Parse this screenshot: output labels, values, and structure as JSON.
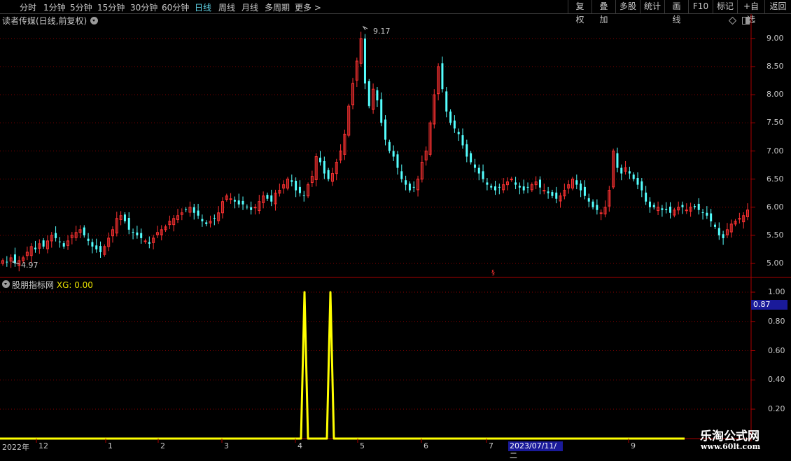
{
  "toolbar": {
    "timeframes": [
      "分时",
      "1分钟",
      "5分钟",
      "15分钟",
      "30分钟",
      "60分钟",
      "日线",
      "周线",
      "月线",
      "多周期",
      "更多 >"
    ],
    "active_timeframe": "日线",
    "right_buttons": [
      "复权",
      "叠加",
      "多股",
      "统计",
      "画线",
      "F10",
      "标记",
      "+自选",
      "返回"
    ]
  },
  "chart_title": "读者传媒(日线,前复权)",
  "price_axis": [
    "9.00",
    "8.50",
    "8.00",
    "7.50",
    "7.00",
    "6.50",
    "6.00",
    "5.50",
    "5.00"
  ],
  "max_label": "9.17",
  "min_label": "4.97",
  "indicator": {
    "name": "股朋指标网",
    "xg_label": "XG: 0.00",
    "axis": [
      "1.00",
      "0.80",
      "0.60",
      "0.40",
      "0.20"
    ],
    "current_value": "0.87"
  },
  "date_axis": {
    "labels": [
      "2022年",
      "12",
      "1",
      "2",
      "3",
      "4",
      "5",
      "6",
      "7",
      "9"
    ],
    "highlight": "2023/07/11/二"
  },
  "watermark": {
    "title": "乐淘公式网",
    "url": "www.60lt.com"
  },
  "colors": {
    "up": "#ff3232",
    "down": "#54ffff",
    "signal": "#ffff00",
    "grid": "#8b0000"
  },
  "chart_data": {
    "type": "candlestick",
    "series": [
      {
        "name": "price",
        "values": [
          5.05,
          5.02,
          5.1,
          5.0,
          5.05,
          5.1,
          5.2,
          5.3,
          5.25,
          5.35,
          5.3,
          5.4,
          5.5,
          5.45,
          5.38,
          5.3,
          5.4,
          5.5,
          5.55,
          5.6,
          5.5,
          5.4,
          5.3,
          5.25,
          5.2,
          5.3,
          5.45,
          5.6,
          5.8,
          5.85,
          5.75,
          5.6,
          5.55,
          5.5,
          5.45,
          5.4,
          5.35,
          5.45,
          5.55,
          5.6,
          5.65,
          5.75,
          5.8,
          5.85,
          5.9,
          5.95,
          6.0,
          5.9,
          5.85,
          5.75,
          5.7,
          5.75,
          5.8,
          5.9,
          6.1,
          6.2,
          6.15,
          6.1,
          6.05,
          6.05,
          6.0,
          5.95,
          6.0,
          6.1,
          6.2,
          6.15,
          6.1,
          6.25,
          6.3,
          6.4,
          6.5,
          6.45,
          6.3,
          6.25,
          6.2,
          6.4,
          6.55,
          6.9,
          6.8,
          6.6,
          6.5,
          6.6,
          6.8,
          7.0,
          7.3,
          7.8,
          8.2,
          8.6,
          9.0,
          8.2,
          7.8,
          8.1,
          7.9,
          7.5,
          7.2,
          7.0,
          6.9,
          6.7,
          6.5,
          6.4,
          6.3,
          6.35,
          6.5,
          6.8,
          7.0,
          7.5,
          8.0,
          8.5,
          8.1,
          7.7,
          7.5,
          7.4,
          7.3,
          7.1,
          6.9,
          6.8,
          6.7,
          6.6,
          6.5,
          6.4,
          6.35,
          6.3,
          6.35,
          6.4,
          6.45,
          6.5,
          6.4,
          6.35,
          6.3,
          6.35,
          6.4,
          6.45,
          6.35,
          6.3,
          6.25,
          6.2,
          6.15,
          6.2,
          6.3,
          6.4,
          6.5,
          6.4,
          6.3,
          6.2,
          6.1,
          6.0,
          5.95,
          5.9,
          6.0,
          6.3,
          7.0,
          6.7,
          6.6,
          6.7,
          6.6,
          6.5,
          6.4,
          6.3,
          6.1,
          6.0,
          6.0,
          6.0,
          5.95,
          5.95,
          5.9,
          5.95,
          6.0,
          6.0,
          5.95,
          6.0,
          6.0,
          5.95,
          5.9,
          5.85,
          5.75,
          5.65,
          5.5,
          5.45,
          5.6,
          5.7,
          5.75,
          5.8,
          5.85,
          5.95
        ]
      },
      {
        "name": "XG",
        "signals": [
          0,
          0,
          0,
          0,
          0,
          0,
          0,
          0,
          0,
          0,
          1,
          0,
          0,
          0,
          1,
          0,
          0,
          0,
          0,
          0,
          0,
          0,
          0,
          0,
          0,
          0,
          0,
          0,
          0,
          0,
          0,
          0
        ]
      }
    ],
    "ylim": [
      4.97,
      9.17
    ]
  }
}
